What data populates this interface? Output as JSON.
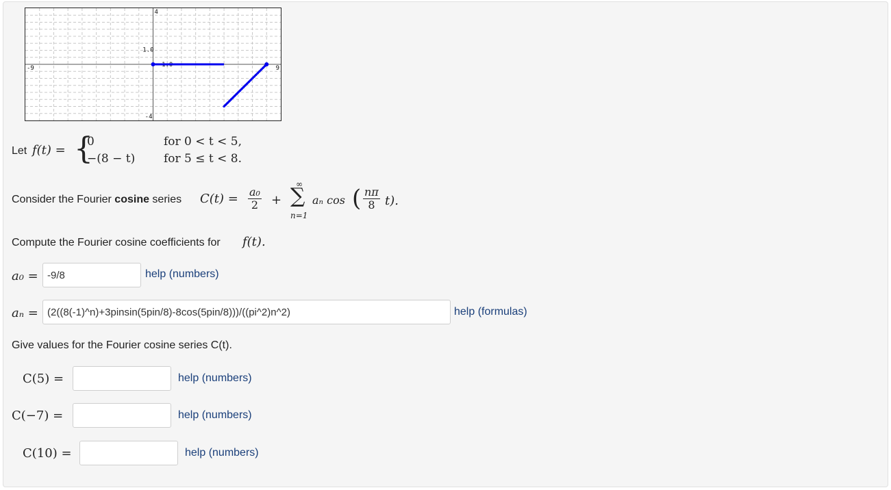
{
  "graph": {
    "ticks": {
      "xmin": "-9",
      "xmax": "9",
      "ymax": "4",
      "ymin": "-4",
      "y1": "1.0",
      "xlab": "1.0"
    }
  },
  "problem": {
    "let": "Let",
    "f_lhs": "f(t) =",
    "case1_expr": "0",
    "case1_cond": "for  0 < t < 5,",
    "case2_expr": "−(8 − t)",
    "case2_cond": "for  5 ≤ t < 8.",
    "consider_pre": "Consider the Fourier ",
    "consider_bold": "cosine",
    "consider_post": " series ",
    "c_lhs": "C(t) =",
    "a0_num": "a₀",
    "a0_den": "2",
    "plus": "+",
    "sum_top": "∞",
    "sum_sym": "∑",
    "sum_bottom": "n=1",
    "an_cos": "aₙ  cos",
    "npi": "nπ",
    "eight": "8",
    "t_close": "t).",
    "open_paren": "(",
    "compute": "Compute the Fourier cosine coefficients for ",
    "compute_f": "f(t)."
  },
  "answers": {
    "a0_label": "a₀ =",
    "a0_value": "-9/8",
    "a0_help": "help (numbers)",
    "an_label": "aₙ =",
    "an_value": "(2((8(-1)^n)+3pinsin(5pin/8)-8cos(5pin/8)))/((pi^2)n^2)",
    "an_help": "help (formulas)",
    "give_values": "Give values for the Fourier cosine series C(t).",
    "c5_label": "C(5) =",
    "c5_value": "",
    "c5_help": "help (numbers)",
    "cm7_label": "C(−7) =",
    "cm7_value": "",
    "cm7_help": "help (numbers)",
    "c10_label": "C(10) =",
    "c10_value": "",
    "c10_help": "help (numbers)"
  },
  "colors": {
    "plot_line": "#0000ee",
    "help_link": "#1a3f7a"
  }
}
